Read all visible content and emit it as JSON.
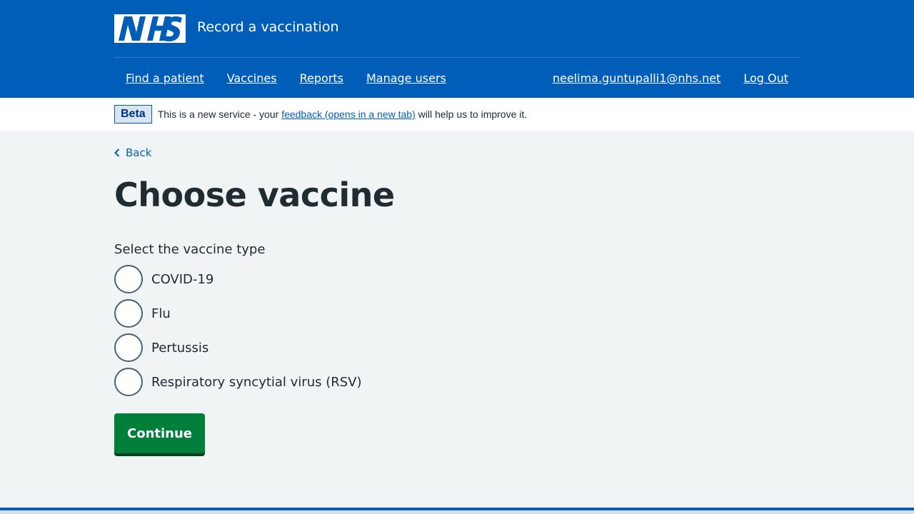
{
  "header": {
    "logo_text": "NHS",
    "service_name": "Record a vaccination"
  },
  "nav": {
    "left": [
      {
        "label": "Find a patient"
      },
      {
        "label": "Vaccines"
      },
      {
        "label": "Reports"
      },
      {
        "label": "Manage users"
      }
    ],
    "user_email": "neelima.guntupalli1@nhs.net",
    "logout_label": "Log Out"
  },
  "beta": {
    "tag": "Beta",
    "text_before": "This is a new service - your ",
    "link_text": "feedback (opens in a new tab)",
    "text_after": " will help us to improve it."
  },
  "back_label": "Back",
  "page_title": "Choose vaccine",
  "question": "Select the vaccine type",
  "options": [
    {
      "label": "COVID-19"
    },
    {
      "label": "Flu"
    },
    {
      "label": "Pertussis"
    },
    {
      "label": "Respiratory syncytial virus (RSV)"
    }
  ],
  "continue_label": "Continue",
  "colors": {
    "brand_blue": "#005eb8",
    "button_green": "#007f3b",
    "background": "#f0f4f5"
  },
  "icons": [
    "nhs-logo",
    "chevron-left-icon"
  ]
}
